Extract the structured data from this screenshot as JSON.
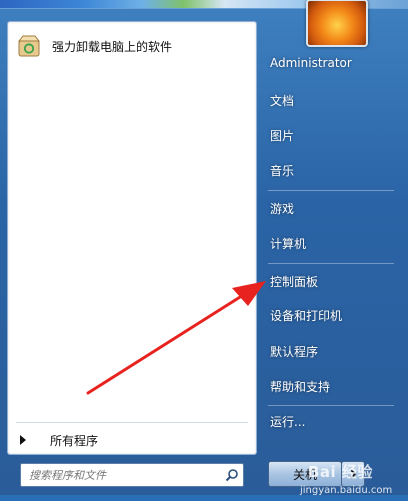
{
  "pinned_programs": [
    {
      "label": "强力卸载电脑上的软件",
      "icon": "uninstall-box-icon"
    }
  ],
  "all_programs_label": "所有程序",
  "search": {
    "placeholder": "搜索程序和文件"
  },
  "user": {
    "picture": "flower-avatar"
  },
  "right_items": [
    {
      "id": "username",
      "label": "Administrator"
    },
    {
      "id": "documents",
      "label": "文档"
    },
    {
      "id": "pictures",
      "label": "图片"
    },
    {
      "id": "music",
      "label": "音乐"
    },
    {
      "id": "games",
      "label": "游戏"
    },
    {
      "id": "computer",
      "label": "计算机"
    },
    {
      "id": "control-panel",
      "label": "控制面板"
    },
    {
      "id": "devices-printers",
      "label": "设备和打印机"
    },
    {
      "id": "default-programs",
      "label": "默认程序"
    },
    {
      "id": "help-support",
      "label": "帮助和支持"
    },
    {
      "id": "run",
      "label": "运行..."
    }
  ],
  "shutdown": {
    "label": "关机"
  },
  "watermark": {
    "logo": "Bai 经验",
    "url": "jingyan.baidu.com"
  },
  "colors": {
    "annotation_arrow": "#e8231f",
    "menu_blue": "#2a64a6"
  }
}
